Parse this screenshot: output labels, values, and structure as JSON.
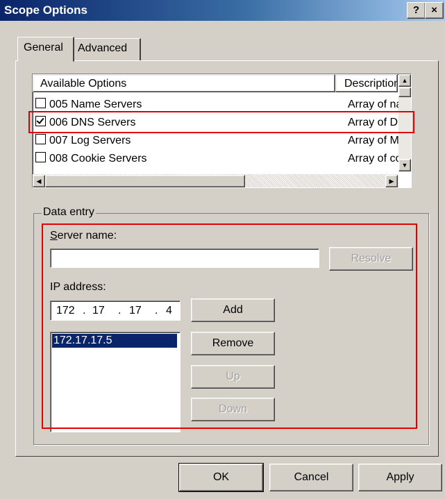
{
  "window": {
    "title": "Scope Options",
    "help_glyph": "?",
    "close_glyph": "×"
  },
  "tabs": [
    {
      "label": "General",
      "active": true
    },
    {
      "label": "Advanced",
      "active": false
    }
  ],
  "options_list": {
    "columns": [
      "Available Options",
      "Description"
    ],
    "rows": [
      {
        "name": "005 Name Servers",
        "description": "Array of nam",
        "checked": false
      },
      {
        "name": "006 DNS Servers",
        "description": "Array of DNS",
        "checked": true
      },
      {
        "name": "007 Log Servers",
        "description": "Array of MIT",
        "checked": false
      },
      {
        "name": "008 Cookie Servers",
        "description": "Array of coo",
        "checked": false
      }
    ]
  },
  "data_entry": {
    "group_label": "Data entry",
    "server_name": {
      "label": "Server name:",
      "value": ""
    },
    "resolve_label": "Resolve",
    "ip_address": {
      "label": "IP address:",
      "octets": [
        "172",
        "17",
        "17",
        "4"
      ]
    },
    "buttons": {
      "add": "Add",
      "remove": "Remove",
      "up": "Up",
      "down": "Down"
    },
    "ip_list": [
      "172.17.17.5"
    ]
  },
  "footer": {
    "ok": "OK",
    "cancel": "Cancel",
    "apply": "Apply"
  },
  "colors": {
    "title_start": "#0a246a",
    "title_end": "#a6caf0",
    "face": "#d4d0c8",
    "selection": "#0a246a",
    "highlight": "#e00000"
  }
}
